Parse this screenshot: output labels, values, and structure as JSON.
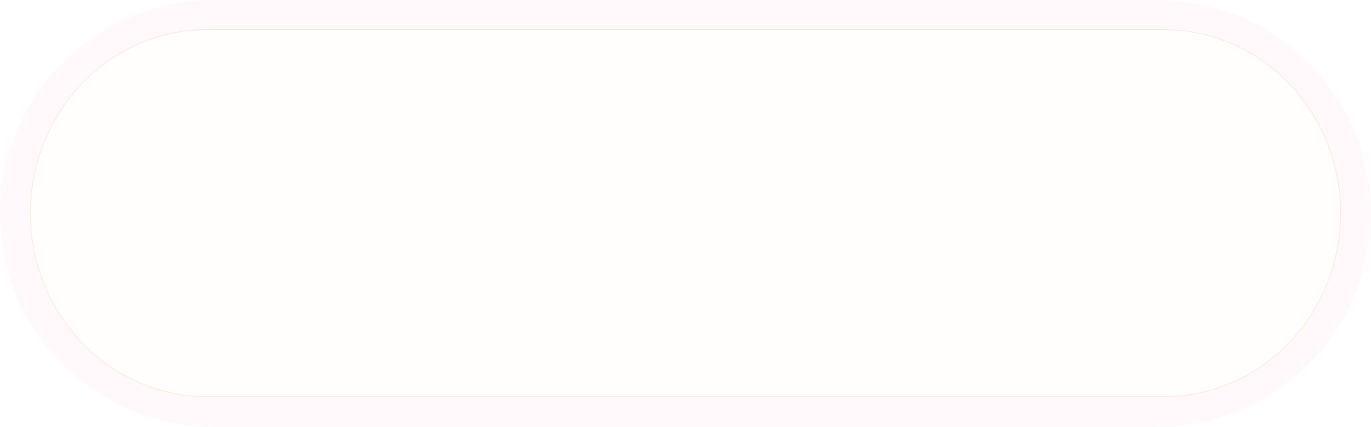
{
  "button": {
    "label": "",
    "frame_color": "#fff9fc",
    "fill_color": "#fffefd",
    "edge_color": "#fbe9d6"
  }
}
